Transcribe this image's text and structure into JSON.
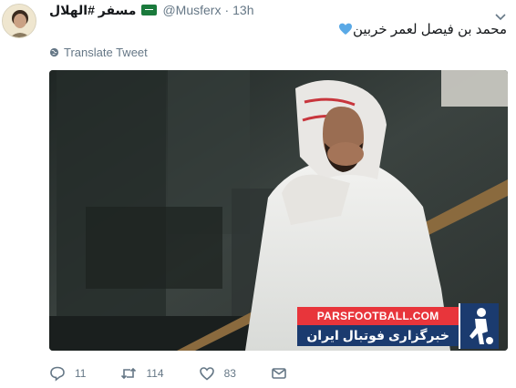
{
  "tweet": {
    "display_name": "مسفر #الهلال",
    "handle": "@Musferx",
    "separator": "·",
    "time": "13h",
    "text": "محمد بن فيصل لعمر خربين",
    "translate_label": "Translate Tweet",
    "actions": {
      "reply_count": "11",
      "retweet_count": "114",
      "like_count": "83"
    }
  },
  "media": {
    "watermark_top": "PARSFOOTBALL.COM",
    "watermark_bottom": "خبرگزاری فوتبال ایران"
  },
  "colors": {
    "heart": "#5aa9e6",
    "muted": "#657786",
    "watermark_red": "#e8353b",
    "watermark_navy": "#1b3b6f"
  },
  "icons": [
    "caret-down-icon",
    "blue-heart-icon",
    "globe-icon",
    "reply-icon",
    "retweet-icon",
    "like-icon",
    "direct-message-icon",
    "saudi-flag-icon"
  ]
}
